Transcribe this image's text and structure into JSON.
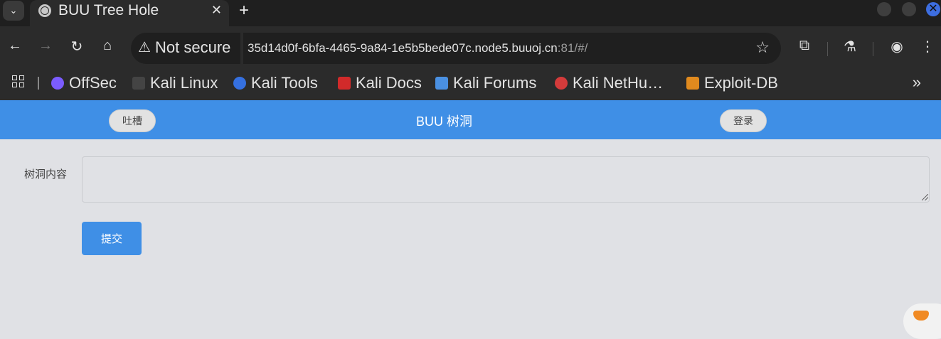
{
  "browser": {
    "tab_list_icon": "chevron-down-icon",
    "tab_title": "BUU Tree Hole",
    "tab_close": "✕",
    "new_tab": "+",
    "security_label": "Not secure",
    "url_host": "35d14d0f-6bfa-4465-9a84-1e5b5bede07c.node5.buuoj.cn",
    "url_rest": ":81/#/",
    "colors": {
      "tabbar": "#1f1f1f",
      "toolbar": "#2b2b2b",
      "window_close": "#3d6ee0"
    }
  },
  "bookmarks": {
    "items": [
      {
        "label": "OffSec",
        "icon": "offsec-icon",
        "color": "#7b5cff"
      },
      {
        "label": "Kali Linux",
        "icon": "kali-dragon-icon",
        "color": "#444444"
      },
      {
        "label": "Kali Tools",
        "icon": "kali-tools-icon",
        "color": "#3570e0"
      },
      {
        "label": "Kali Docs",
        "icon": "kali-docs-icon",
        "color": "#d12a2a"
      },
      {
        "label": "Kali Forums",
        "icon": "kali-forums-icon",
        "color": "#4a90e2"
      },
      {
        "label": "Kali NetHu…",
        "icon": "kali-nethunter-icon",
        "color": "#d43b3b"
      },
      {
        "label": "Exploit-DB",
        "icon": "exploit-db-icon",
        "color": "#e08a1e"
      }
    ],
    "more": "»"
  },
  "page": {
    "nav_left_button": "吐槽",
    "nav_title": "BUU 树洞",
    "nav_right_button": "登录",
    "field_label": "树洞内容",
    "textarea_value": "",
    "submit_label": "提交",
    "colors": {
      "accent": "#3f8fe6",
      "background": "#e0e1e5"
    }
  }
}
